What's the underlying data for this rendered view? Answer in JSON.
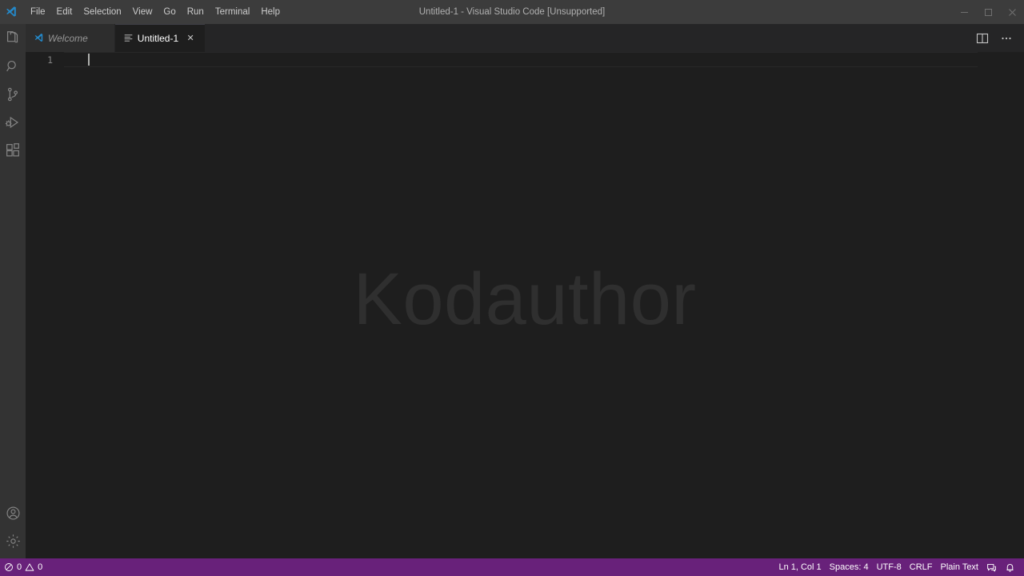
{
  "window": {
    "title": "Untitled-1 - Visual Studio Code [Unsupported]",
    "logo_icon": "vscode-logo-icon",
    "controls": [
      {
        "name": "minimize-button",
        "icon": "minimize-icon",
        "label": "–"
      },
      {
        "name": "maximize-button",
        "icon": "maximize-icon",
        "label": "❐"
      },
      {
        "name": "close-button",
        "icon": "close-icon",
        "label": "✕"
      }
    ]
  },
  "menu": {
    "items": [
      {
        "label": "File"
      },
      {
        "label": "Edit"
      },
      {
        "label": "Selection"
      },
      {
        "label": "View"
      },
      {
        "label": "Go"
      },
      {
        "label": "Run"
      },
      {
        "label": "Terminal"
      },
      {
        "label": "Help"
      }
    ]
  },
  "activitybar": {
    "top_items": [
      {
        "label": "Explorer",
        "icon": "files-icon",
        "active": true
      },
      {
        "label": "Search",
        "icon": "search-icon",
        "active": false
      },
      {
        "label": "Source Control",
        "icon": "source-control-icon",
        "active": false
      },
      {
        "label": "Run and Debug",
        "icon": "run-debug-icon",
        "active": false
      },
      {
        "label": "Extensions",
        "icon": "extensions-icon",
        "active": false
      }
    ],
    "bottom_items": [
      {
        "label": "Accounts",
        "icon": "account-icon"
      },
      {
        "label": "Manage",
        "icon": "gear-icon"
      }
    ]
  },
  "tabs": [
    {
      "label": "Welcome",
      "icon": "vscode-logo-icon",
      "active": false,
      "close_label": "✕"
    },
    {
      "label": "Untitled-1",
      "icon": "plaintext-file-icon",
      "active": true,
      "close_label": "✕"
    }
  ],
  "editor_actions": [
    {
      "label": "Split Editor Right",
      "icon": "split-editor-icon"
    },
    {
      "label": "More Actions...",
      "icon": "ellipsis-icon"
    }
  ],
  "editor": {
    "line_number": "1",
    "content": "",
    "watermark": "Kodauthor"
  },
  "statusbar": {
    "left": [
      {
        "name": "problems-errors",
        "icon": "error-icon",
        "value": "0"
      },
      {
        "name": "problems-warnings",
        "icon": "warning-icon",
        "value": "0"
      }
    ],
    "right": [
      {
        "name": "editor-position",
        "value": "Ln 1, Col 1"
      },
      {
        "name": "editor-indentation",
        "value": "Spaces: 4"
      },
      {
        "name": "editor-encoding",
        "value": "UTF-8"
      },
      {
        "name": "editor-eol",
        "value": "CRLF"
      },
      {
        "name": "editor-language",
        "value": "Plain Text"
      },
      {
        "name": "feedback",
        "icon": "feedback-icon",
        "value": ""
      },
      {
        "name": "notifications",
        "icon": "bell-icon",
        "value": ""
      }
    ],
    "background": "#68217a"
  },
  "colors": {
    "titlebar_bg": "#3c3c3c",
    "activitybar_bg": "#333333",
    "tabbar_bg": "#252526",
    "tab_inactive_bg": "#2d2d2d",
    "editor_bg": "#1e1e1e",
    "statusbar_bg": "#68217a",
    "accent_blue": "#2489ca",
    "watermark_color": "#2f2f2f"
  }
}
